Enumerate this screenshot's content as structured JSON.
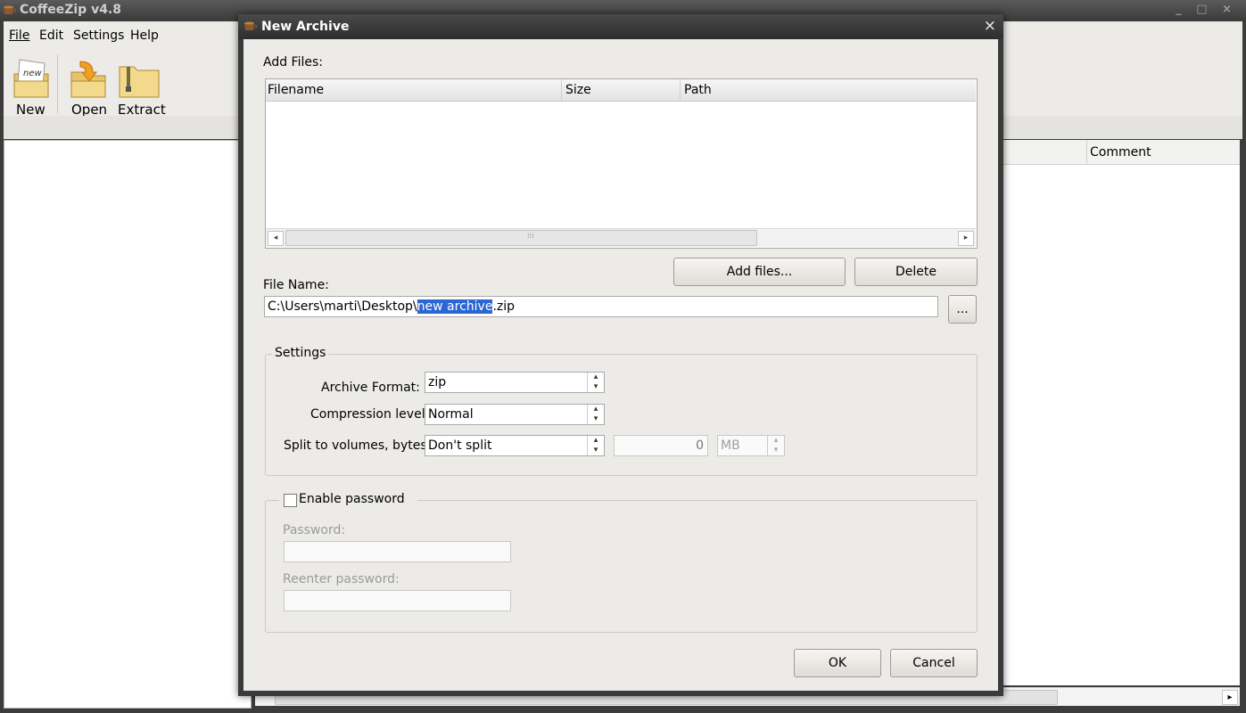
{
  "app": {
    "title": "CoffeeZip v4.8",
    "window_controls": "_ □ ×"
  },
  "menu": {
    "file": "File",
    "edit": "Edit",
    "settings": "Settings",
    "help": "Help"
  },
  "toolbar": {
    "new_label": "New",
    "open_label": "Open",
    "extract_label": "Extract",
    "new_icon_text": "new"
  },
  "main_list": {
    "comment_header": "Comment"
  },
  "dialog": {
    "title": "New Archive",
    "close_symbol": "×",
    "add_files_label": "Add Files:",
    "columns": {
      "filename": "Filename",
      "size": "Size",
      "path": "Path"
    },
    "scroll_left": "◂",
    "scroll_right": "▸",
    "scroll_grip": "⁞⁞⁞",
    "add_files_button": "Add files...",
    "delete_button": "Delete",
    "file_name_label": "File Name:",
    "file_name_prefix": "C:\\Users\\marti\\Desktop\\",
    "file_name_selected": "new archive",
    "file_name_suffix": ".zip",
    "browse_button": "...",
    "settings_group": "Settings",
    "archive_format_label": "Archive Format:",
    "archive_format_value": "zip",
    "compression_label": "Compression level:",
    "compression_value": "Normal",
    "split_label": "Split to volumes, bytes:",
    "split_value": "Don't split",
    "split_size_value": "0",
    "split_unit_value": "MB",
    "enable_password_label": "Enable password",
    "password_label": "Password:",
    "reenter_password_label": "Reenter password:",
    "password_value": "",
    "reenter_password_value": "",
    "ok_button": "OK",
    "cancel_button": "Cancel"
  },
  "colors": {
    "selection": "#2c66d3",
    "dialog_bg": "#ecebe7",
    "titlebar": "#2e2e2e"
  }
}
